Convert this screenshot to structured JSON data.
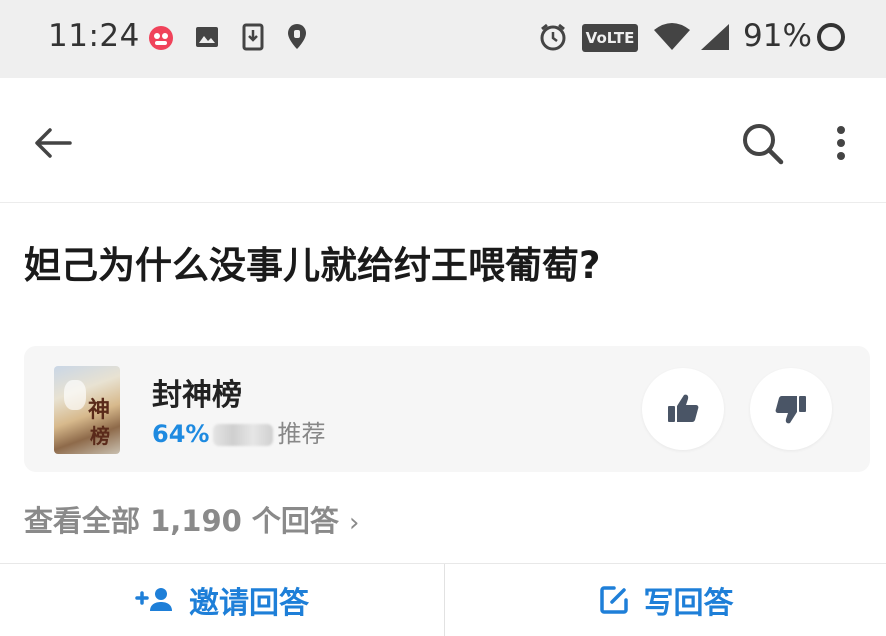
{
  "status_bar": {
    "time": "11:24",
    "battery": "91%",
    "network_label": "VoLTE",
    "icons": [
      "app-notification-icon",
      "image-icon",
      "download-icon",
      "location-icon",
      "alarm-icon",
      "volte-icon",
      "wifi-icon",
      "signal-icon",
      "battery-icon"
    ]
  },
  "app_bar": {
    "icons": [
      "back-arrow-icon",
      "search-icon",
      "more-vertical-icon"
    ]
  },
  "question": {
    "title": "妲己为什么没事儿就给纣王喂葡萄?"
  },
  "topic_card": {
    "name": "封神榜",
    "percent": "64%",
    "recommend_label": "推荐",
    "cover_text": "封神榜"
  },
  "answers_link": {
    "label": "查看全部 1,190 个回答",
    "chevron": "›"
  },
  "bottom_bar": {
    "invite_label": "邀请回答",
    "write_label": "写回答"
  },
  "colors": {
    "accent": "#1e7fd8",
    "status_bar_bg": "#efefef",
    "card_bg": "#f6f6f6"
  }
}
